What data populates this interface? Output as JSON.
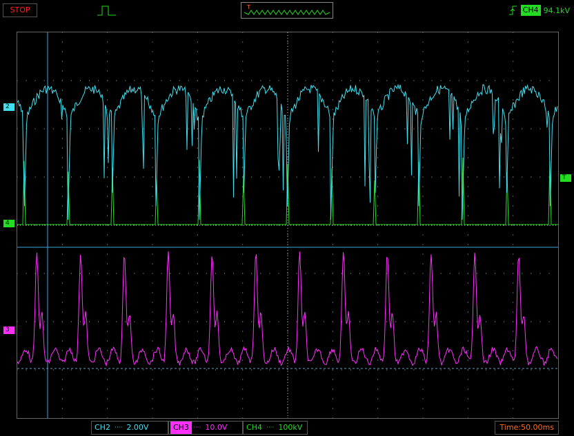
{
  "status": {
    "run_state": "STOP"
  },
  "trigger": {
    "source": "CH4",
    "level": "94.1kV",
    "preview_marker": "T"
  },
  "markers": {
    "ch2": "2",
    "ch4": "4",
    "ch3": "3",
    "trigger": "T"
  },
  "channels": [
    {
      "name": "CH2",
      "coupling": "····",
      "volts_div": "2.00V",
      "color": "#40e0f0"
    },
    {
      "name": "CH3",
      "coupling": "····",
      "volts_div": "10.0V",
      "color": "#ff30ff"
    },
    {
      "name": "CH4",
      "coupling": "····",
      "volts_div": "100kV",
      "color": "#22dd22"
    }
  ],
  "timebase": {
    "label": "Time:50.00ms"
  },
  "colors": {
    "ch2": "#40e0f0",
    "ch3": "#ff30ff",
    "ch4": "#22dd22",
    "stop": "#ff2020",
    "time": "#ff6a1a",
    "grid": "#cccccc"
  }
}
